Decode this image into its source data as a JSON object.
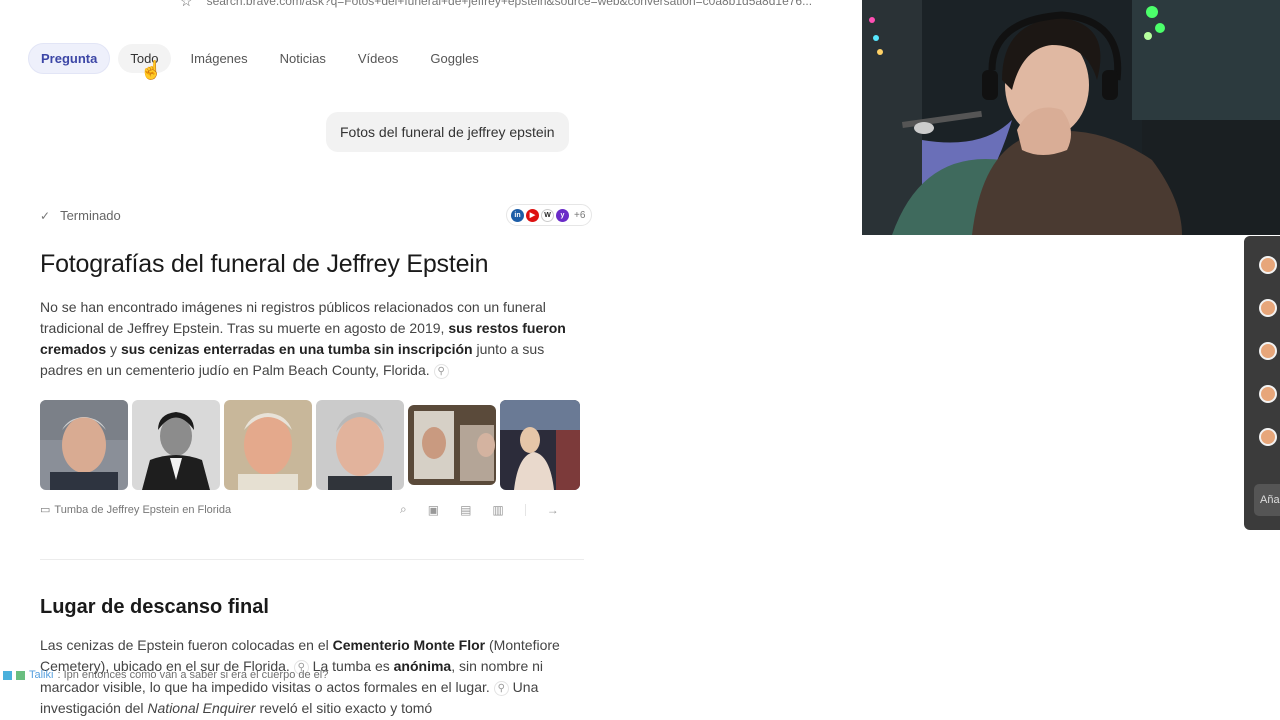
{
  "browser": {
    "url": "search.brave.com/ask?q=Fotos+del+funeral+de+jeffrey+epstein&source=web&conversation=c0a8b1d5a8d1e76..."
  },
  "tabs": [
    {
      "label": "Pregunta"
    },
    {
      "label": "Todo"
    },
    {
      "label": "Imágenes"
    },
    {
      "label": "Noticias"
    },
    {
      "label": "Vídeos"
    },
    {
      "label": "Goggles"
    }
  ],
  "query": "Fotos del funeral de jeffrey epstein",
  "status": {
    "label": "Terminado",
    "sources_more": "+6"
  },
  "answer": {
    "title": "Fotografías del funeral de Jeffrey Epstein",
    "p1_a": "No se han encontrado imágenes ni registros públicos relacionados con un funeral tradicional de Jeffrey Epstein. Tras su muerte en agosto de 2019, ",
    "p1_b": "sus restos fueron cremados",
    "p1_c": " y ",
    "p1_d": "sus cenizas enterradas en una tumba sin inscripción",
    "p1_e": " junto a sus padres en un cementerio judío en Palm Beach County, Florida.",
    "image_caption": "Tumba de Jeffrey Epstein en Florida",
    "section_title": "Lugar de descanso final",
    "p2_a": "Las cenizas de Epstein fueron colocadas en el ",
    "p2_b": "Cementerio Monte Flor",
    "p2_c": " (Montefiore Cemetery), ubicado en el sur de Florida.",
    "p2_d": " La tumba es ",
    "p2_e": "anónima",
    "p2_f": ", sin nombre ni marcador visible, lo que ha impedido visitas o actos formales en el lugar.",
    "p2_g": " Una investigación del ",
    "p2_h": "National Enquirer",
    "p2_i": " reveló el sitio exacto y tomó"
  },
  "chat_overlay": {
    "user": "Taliki",
    "message": ": Ipn entonces como van a saber si era el cuerpo de el?"
  },
  "side_panel": {
    "add_label": "Aña"
  },
  "colors": {
    "active_tab_bg": "#eef0fb",
    "active_tab_text": "#3c46a6"
  }
}
